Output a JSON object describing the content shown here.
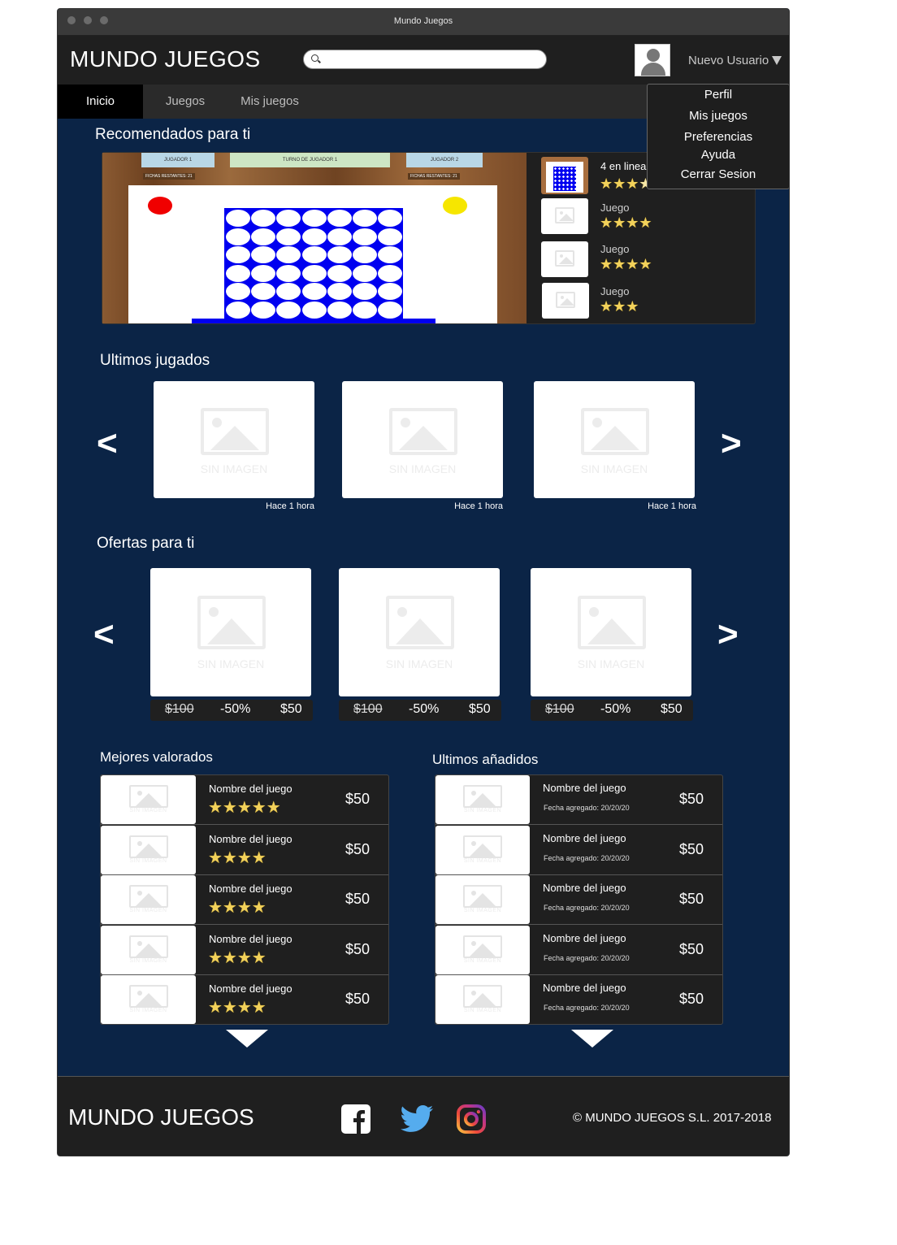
{
  "window": {
    "title": "Mundo Juegos"
  },
  "header": {
    "logo": "MUNDO JUEGOS",
    "search_placeholder": "",
    "user_name": "Nuevo Usuario"
  },
  "nav": {
    "tabs": [
      {
        "label": "Inicio",
        "active": true
      },
      {
        "label": "Juegos"
      },
      {
        "label": "Mis juegos"
      }
    ]
  },
  "user_menu": {
    "items": [
      "Perfil",
      "Mis juegos",
      "Preferencias",
      "Ayuda",
      "Cerrar Sesion"
    ]
  },
  "recommended": {
    "title": "Recomendados para ti",
    "featured": {
      "player1": "JUGADOR 1",
      "turn": "TURNO DE JUGADOR 1",
      "player2": "JUGADOR 2",
      "remaining1": "FICHAS RESTANTES: 21",
      "remaining2": "FICHAS RESTANTES: 21"
    },
    "items": [
      {
        "name": "4 en linea",
        "rating": 3,
        "rating_shown": 5
      },
      {
        "name": "Juego",
        "rating": 4
      },
      {
        "name": "Juego",
        "rating": 4
      },
      {
        "name": "Juego",
        "rating": 3
      }
    ]
  },
  "recent": {
    "title": "Ultimos jugados",
    "prev": "<",
    "next": ">",
    "items": [
      {
        "image_text": "SIN IMAGEN",
        "time": "Hace 1 hora"
      },
      {
        "image_text": "SIN IMAGEN",
        "time": "Hace 1 hora"
      },
      {
        "image_text": "SIN IMAGEN",
        "time": "Hace 1 hora"
      }
    ]
  },
  "offers": {
    "title": "Ofertas para ti",
    "prev": "<",
    "next": ">",
    "items": [
      {
        "image_text": "SIN IMAGEN",
        "old_price": "$100",
        "discount": "-50%",
        "price": "$50"
      },
      {
        "image_text": "SIN IMAGEN",
        "old_price": "$100",
        "discount": "-50%",
        "price": "$50"
      },
      {
        "image_text": "SIN IMAGEN",
        "old_price": "$100",
        "discount": "-50%",
        "price": "$50"
      }
    ]
  },
  "top_rated": {
    "title": "Mejores valorados",
    "items": [
      {
        "name": "Nombre del juego",
        "rating": 5,
        "price": "$50",
        "image_text": "SIN IMAGEN"
      },
      {
        "name": "Nombre del juego",
        "rating": 4,
        "price": "$50",
        "image_text": "SIN IMAGEN"
      },
      {
        "name": "Nombre del juego",
        "rating": 4,
        "price": "$50",
        "image_text": "SIN IMAGEN"
      },
      {
        "name": "Nombre del juego",
        "rating": 4,
        "price": "$50",
        "image_text": "SIN IMAGEN"
      },
      {
        "name": "Nombre del juego",
        "rating": 4,
        "price": "$50",
        "image_text": "SIN IMAGEN"
      }
    ]
  },
  "latest_added": {
    "title": "Ultimos añadidos",
    "items": [
      {
        "name": "Nombre del juego",
        "date": "Fecha agregado: 20/20/20",
        "price": "$50",
        "image_text": "SIN IMAGEN"
      },
      {
        "name": "Nombre del juego",
        "date": "Fecha agregado: 20/20/20",
        "price": "$50",
        "image_text": "SIN IMAGEN"
      },
      {
        "name": "Nombre del juego",
        "date": "Fecha agregado: 20/20/20",
        "price": "$50",
        "image_text": "SIN IMAGEN"
      },
      {
        "name": "Nombre del juego",
        "date": "Fecha agregado: 20/20/20",
        "price": "$50",
        "image_text": "SIN IMAGEN"
      },
      {
        "name": "Nombre del juego",
        "date": "Fecha agregado: 20/20/20",
        "price": "$50",
        "image_text": "SIN IMAGEN"
      }
    ]
  },
  "footer": {
    "logo": "MUNDO JUEGOS",
    "social": [
      "facebook-icon",
      "twitter-icon",
      "instagram-icon"
    ],
    "copyright": "© MUNDO JUEGOS S.L. 2017-2018"
  },
  "colors": {
    "background": "#0b2446",
    "bars": "#1f1f1f",
    "star": "#f2d15a",
    "grid": "#0000f0"
  }
}
